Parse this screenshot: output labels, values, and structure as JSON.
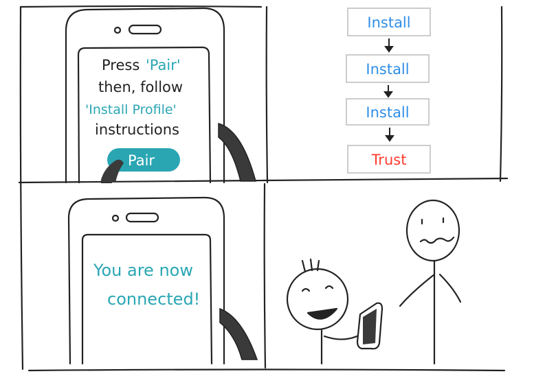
{
  "panel1": {
    "line1_a": "Press",
    "line1_b": "'Pair'",
    "line2": "then, follow",
    "line3": "'Install Profile'",
    "line4": "instructions",
    "button_label": "Pair"
  },
  "panel2": {
    "steps": [
      "Install",
      "Install",
      "Install",
      "Trust"
    ]
  },
  "panel3": {
    "line1": "You are now",
    "line2": "connected!"
  },
  "colors": {
    "teal": "#2aa6b3",
    "blue": "#2f8ee6",
    "red": "#ff3b30",
    "ink": "#222222"
  }
}
